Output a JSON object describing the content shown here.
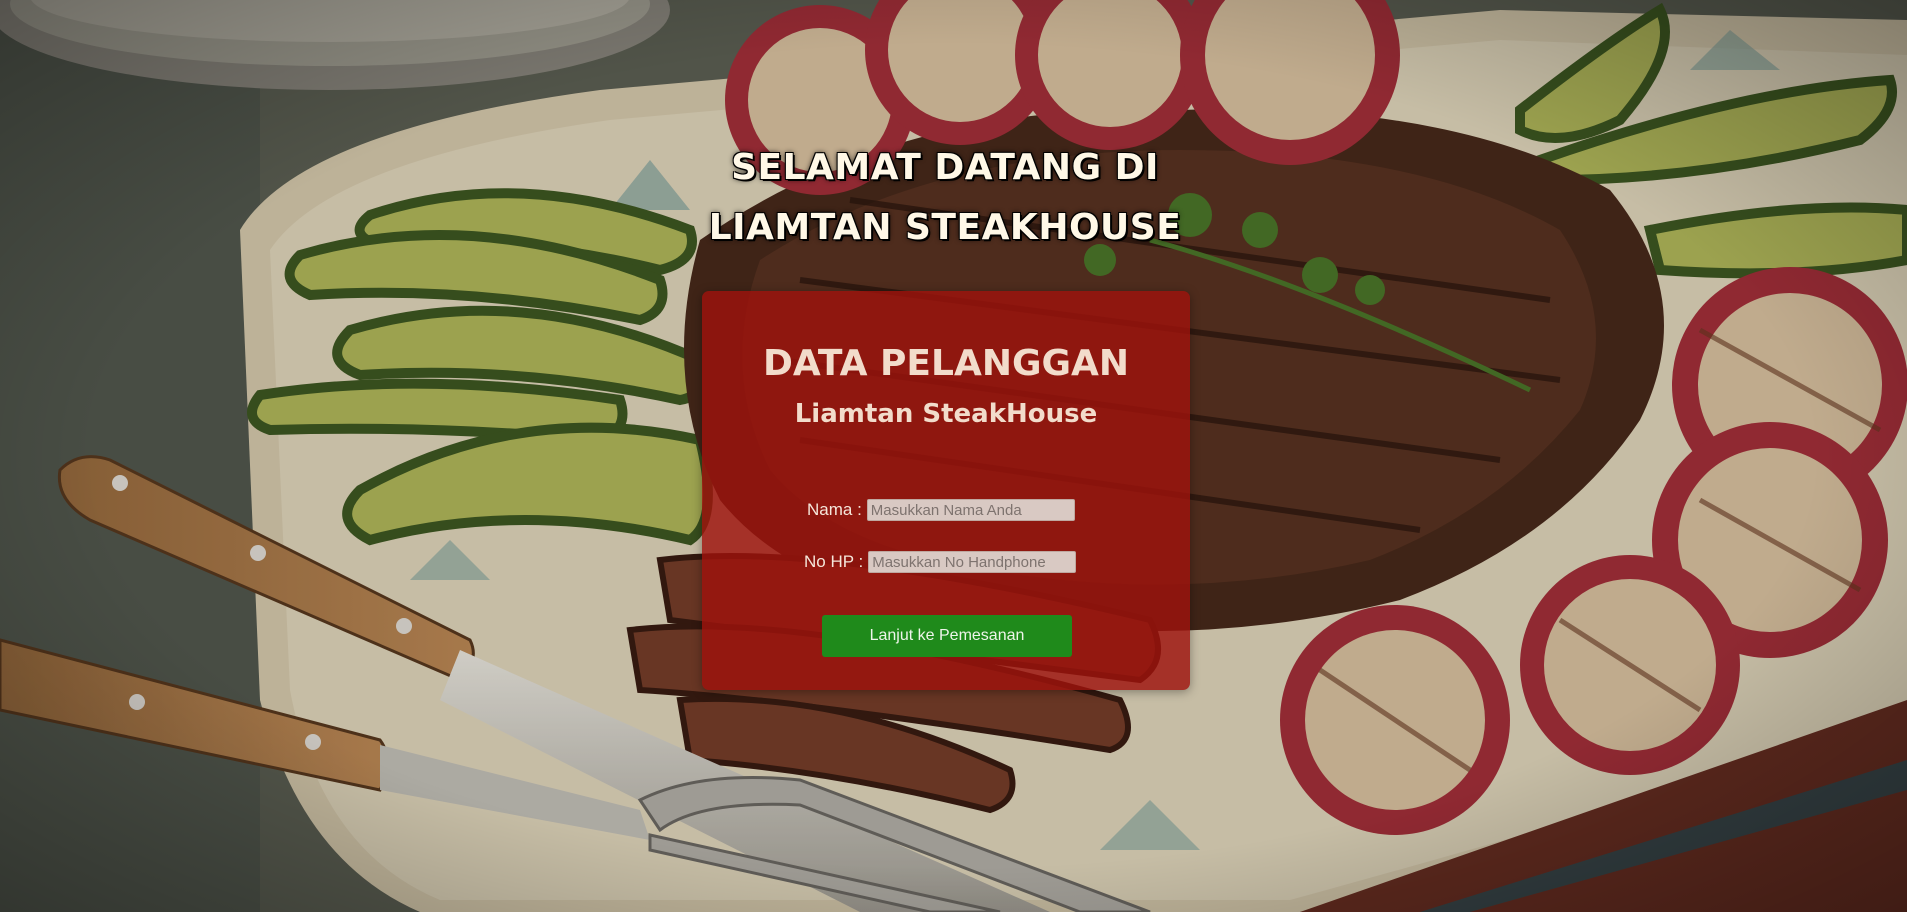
{
  "welcome": {
    "line1": "SELAMAT DATANG DI",
    "line2": "LIAMTAN STEAKHOUSE"
  },
  "form": {
    "title": "DATA PELANGGAN",
    "subtitle": "Liamtan SteakHouse",
    "nama_label": "Nama :",
    "nama_placeholder": "Masukkan Nama Anda",
    "nama_value": "",
    "hp_label": "No HP :",
    "hp_placeholder": "Masukkan No Handphone",
    "hp_value": "",
    "submit_label": "Lanjut ke Pemesanan"
  },
  "colors": {
    "panel": "#9e120c",
    "button": "#1f8a1b",
    "text": "#f2dccb"
  }
}
